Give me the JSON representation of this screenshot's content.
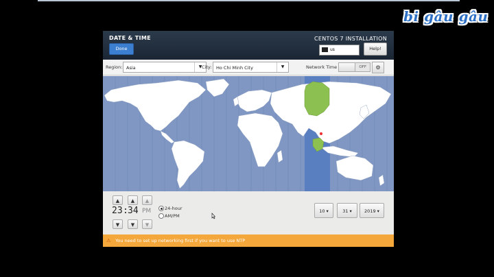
{
  "watermark": "bi gâu gâu",
  "header": {
    "title": "DATE & TIME",
    "done_label": "Done",
    "product": "CENTOS 7 INSTALLATION",
    "keyboard_layout": "us",
    "help_label": "Help!"
  },
  "toolbar": {
    "region_label": "Region:",
    "region_value": "Asia",
    "city_label": "City:",
    "city_value": "Ho Chi Minh City",
    "network_time_label": "Network Time",
    "network_time_state": "OFF"
  },
  "time": {
    "hours": "23",
    "separator": ":",
    "minutes": "34",
    "ampm": "PM",
    "format_24h_label": "24-hour",
    "format_ampm_label": "AM/PM",
    "selected_format": "24-hour"
  },
  "date": {
    "month": "10",
    "day": "31",
    "year": "2019",
    "separator": "/"
  },
  "warning": {
    "message": "You need to set up networking first if you want to use NTP"
  },
  "colors": {
    "ocean": "#7f97c2",
    "timezone_band": "#5a7fc0",
    "selected_country": "#8cc051",
    "warning_bar": "#f4a73a",
    "header": "#1f2b3a",
    "done_button": "#3c7fd0"
  }
}
